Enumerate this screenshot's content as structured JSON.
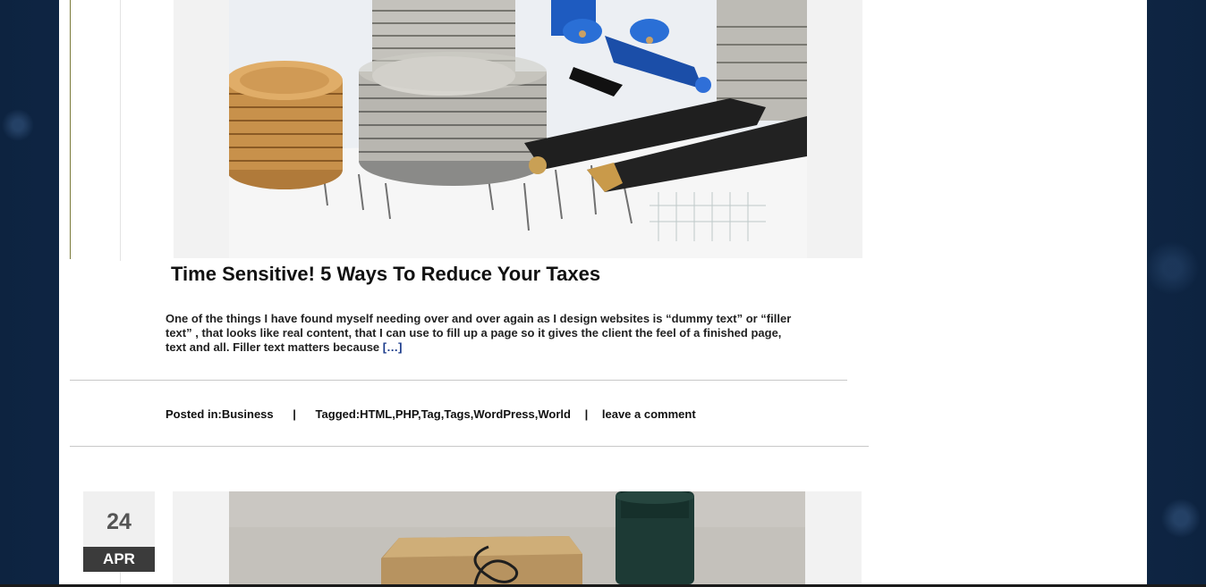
{
  "post1": {
    "title": "Time Sensitive! 5 Ways To Reduce Your Taxes",
    "excerpt": "One of the things I have found myself needing over and over again as I design websites is  “dummy text”  or  “filler text” , that looks like real content, that I can use to fill up a page so it gives the client the feel of a finished page, text and all. Filler text matters because ",
    "read_more": "[…]",
    "meta": {
      "posted_in_label": "Posted in:",
      "category": "Business",
      "separator": "|",
      "tagged_label": "Tagged:",
      "tags": [
        "HTML",
        "PHP",
        "Tag",
        "Tags",
        "WordPress",
        "World"
      ],
      "comment_link": "leave a comment"
    }
  },
  "post2": {
    "date_day": "24",
    "date_month": "APR"
  },
  "colors": {
    "background": "#0f2a4a",
    "page": "#ffffff",
    "date_month_bg": "#3b3b3b",
    "date_day_bg": "#f0f0f0"
  }
}
